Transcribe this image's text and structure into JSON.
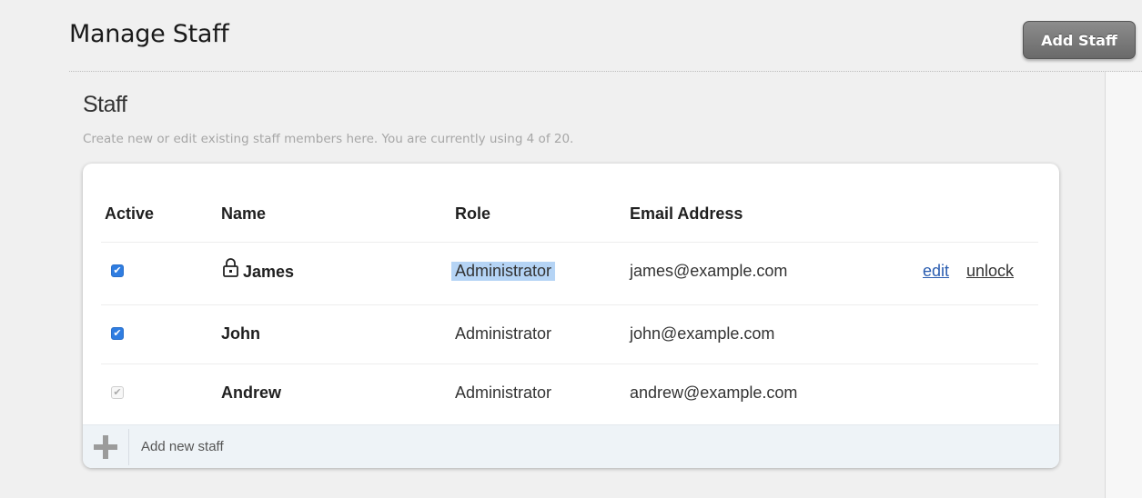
{
  "header": {
    "title": "Manage Staff",
    "add_staff_label": "Add Staff"
  },
  "section": {
    "title": "Staff",
    "description": "Create new or edit existing staff members here. You are currently using 4 of 20."
  },
  "table": {
    "columns": [
      "Active",
      "Name",
      "Role",
      "Email Address"
    ],
    "rows": [
      {
        "active": true,
        "locked": true,
        "name": "James",
        "role": "Administrator",
        "role_selected": true,
        "email": "james@example.com",
        "actions": [
          "edit",
          "unlock"
        ]
      },
      {
        "active": true,
        "locked": false,
        "name": "John",
        "role": "Administrator",
        "role_selected": false,
        "email": "john@example.com",
        "actions": []
      },
      {
        "active": false,
        "locked": false,
        "name": "Andrew",
        "role": "Administrator",
        "role_selected": false,
        "email": "andrew@example.com",
        "actions": []
      }
    ],
    "add_new_label": "Add new staff"
  },
  "icons": {
    "checkmark": "check-icon",
    "lock": "lock-icon",
    "add": "plus-icon"
  },
  "colors": {
    "checkbox_checked": "#2f7de1",
    "selection_highlight": "#b5d4f5",
    "link": "#2a5db0",
    "button": "#787878"
  }
}
